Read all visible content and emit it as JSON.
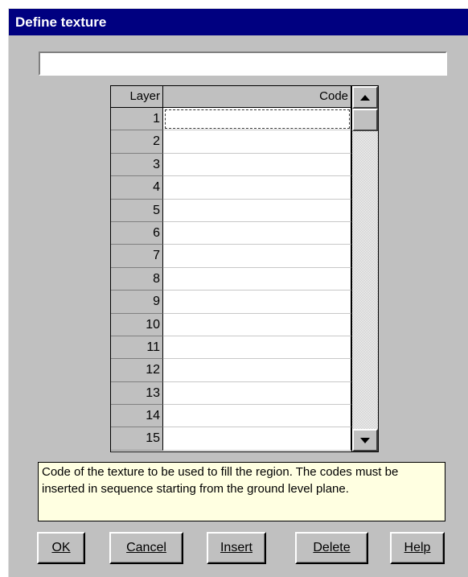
{
  "dialog": {
    "title": "Define texture"
  },
  "name_field": {
    "value": "",
    "placeholder": ""
  },
  "grid": {
    "columns": [
      "Layer",
      "Code"
    ],
    "rows": [
      {
        "layer": "1",
        "code": ""
      },
      {
        "layer": "2",
        "code": ""
      },
      {
        "layer": "3",
        "code": ""
      },
      {
        "layer": "4",
        "code": ""
      },
      {
        "layer": "5",
        "code": ""
      },
      {
        "layer": "6",
        "code": ""
      },
      {
        "layer": "7",
        "code": ""
      },
      {
        "layer": "8",
        "code": ""
      },
      {
        "layer": "9",
        "code": ""
      },
      {
        "layer": "10",
        "code": ""
      },
      {
        "layer": "11",
        "code": ""
      },
      {
        "layer": "12",
        "code": ""
      },
      {
        "layer": "13",
        "code": ""
      },
      {
        "layer": "14",
        "code": ""
      },
      {
        "layer": "15",
        "code": ""
      }
    ],
    "active_row": 0
  },
  "hint": {
    "text": "Code of the texture to be used to fill the region. The codes must be inserted in sequence starting from the ground level plane."
  },
  "buttons": {
    "ok": "OK",
    "cancel": "Cancel",
    "insert": "Insert",
    "delete": "Delete",
    "help": "Help"
  },
  "colors": {
    "titlebar": "#000080",
    "dialog_bg": "#c0c0c0",
    "hint_bg": "#ffffe1"
  }
}
